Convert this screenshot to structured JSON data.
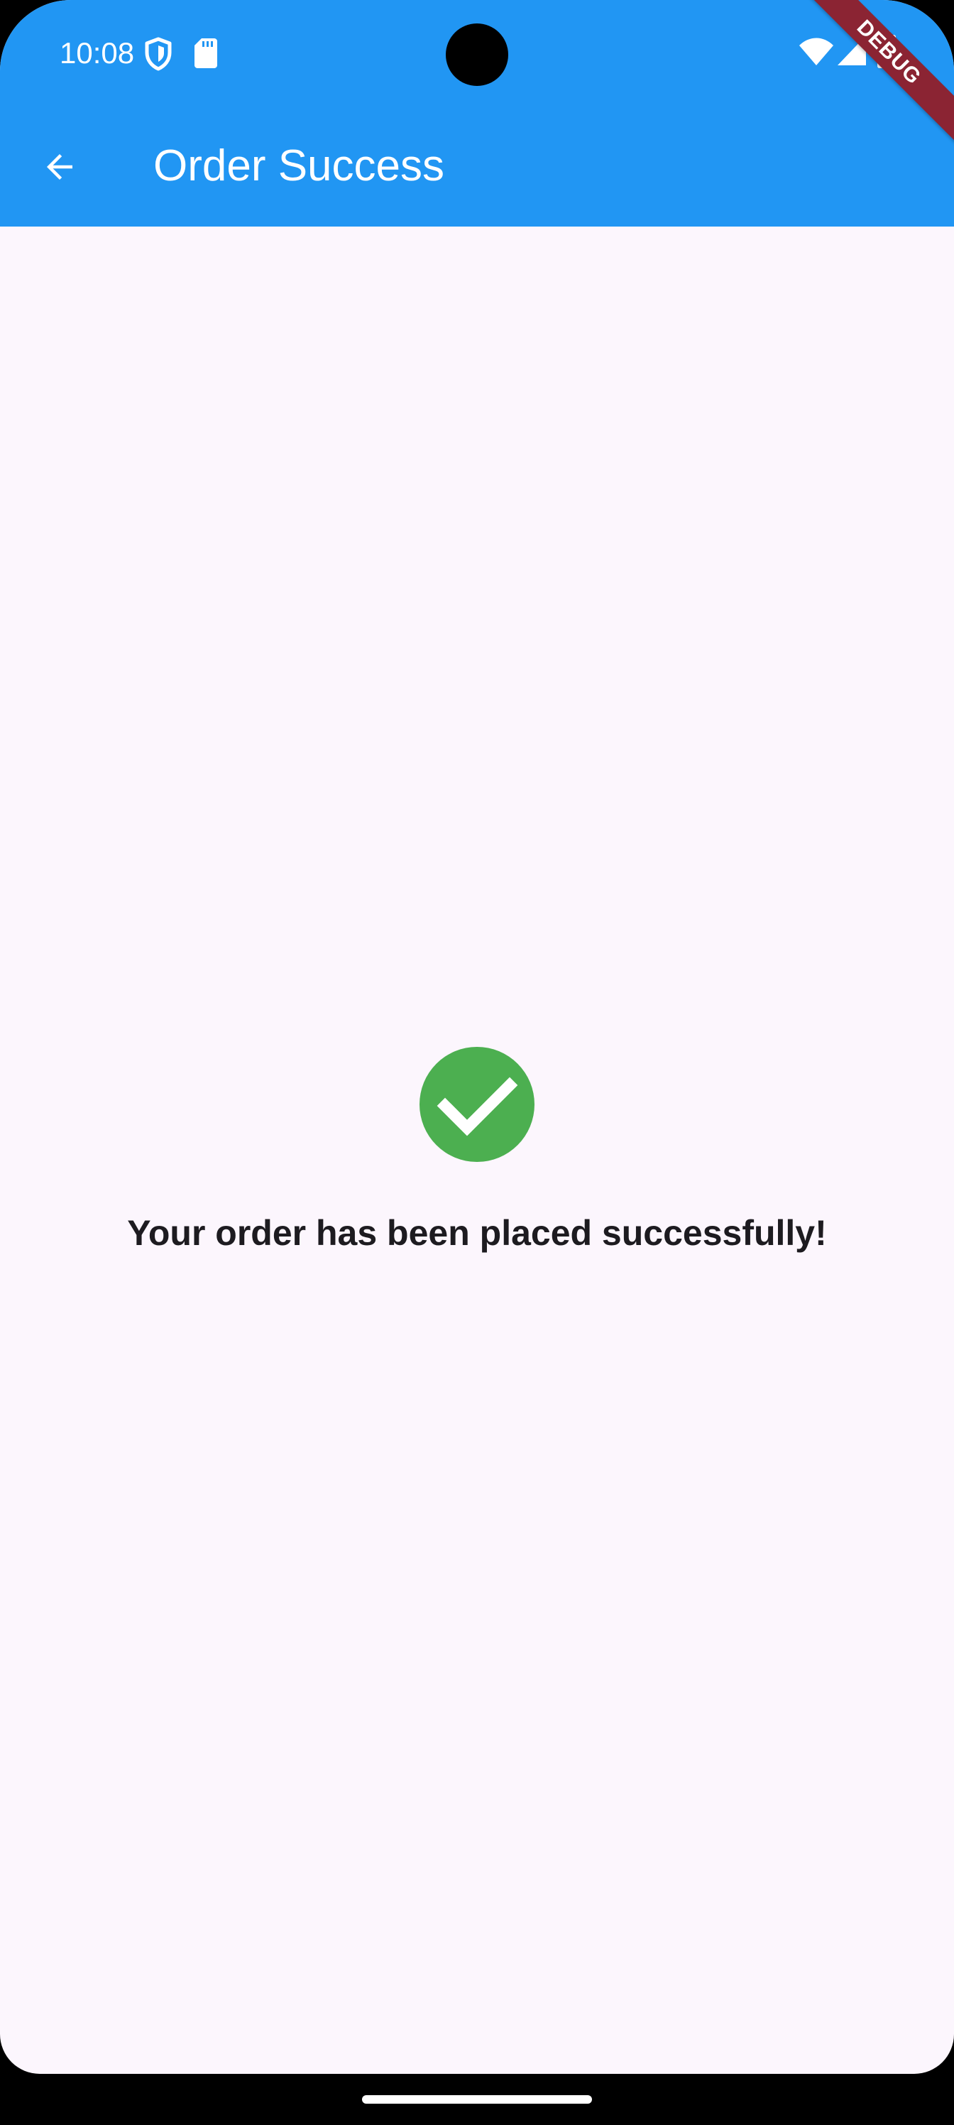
{
  "status_bar": {
    "time": "10:08",
    "icons": [
      "shield-icon",
      "sd-card-icon",
      "wifi-icon",
      "cell-signal-icon",
      "battery-icon"
    ]
  },
  "app_bar": {
    "title": "Order Success",
    "back_icon": "arrow-back-icon",
    "background_color": "#2196F3"
  },
  "debug_banner": {
    "label": "DEBUG",
    "color": "#8B2433"
  },
  "main": {
    "icon": "check-circle-icon",
    "icon_color": "#4CAF50",
    "message": "Your order has been placed successfully!"
  },
  "colors": {
    "background": "#FCF6FD",
    "text": "#1D1B20"
  }
}
